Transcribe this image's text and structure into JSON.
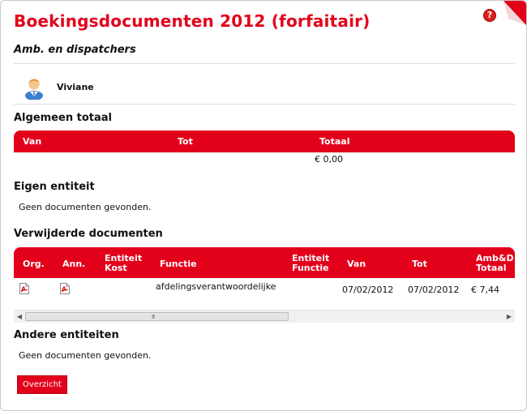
{
  "page": {
    "title": "Boekingsdocumenten 2012 (forfaitair)",
    "subtitle": "Amb. en dispatchers",
    "help_symbol": "?"
  },
  "user": {
    "name": "Viviane",
    "icon": "user-avatar-icon"
  },
  "general_total": {
    "heading": "Algemeen totaal",
    "columns": [
      "Van",
      "Tot",
      "Totaal"
    ],
    "row": {
      "van": "",
      "tot": "",
      "totaal": "€ 0,00"
    }
  },
  "own_entity": {
    "heading": "Eigen entiteit",
    "empty_text": "Geen documenten gevonden."
  },
  "removed_documents": {
    "heading": "Verwijderde documenten",
    "columns": {
      "org": "Org.",
      "ann": "Ann.",
      "entiteit_kost_1": "Entiteit",
      "entiteit_kost_2": "Kost",
      "functie": "Functie",
      "entiteit_functie_1": "Entiteit",
      "entiteit_functie_2": "Functie",
      "van": "Van",
      "tot": "Tot",
      "amb_totaal_1": "Amb&D",
      "amb_totaal_2": "Totaal"
    },
    "rows": [
      {
        "org_icon": "pdf-icon",
        "ann_icon": "pdf-icon",
        "entiteit_kost": "",
        "functie": "afdelingsverantwoordelijke",
        "entiteit_functie": "",
        "van": "07/02/2012",
        "tot": "07/02/2012",
        "amb_totaal": "€ 7,44"
      }
    ],
    "scroll": {
      "left_arrow": "◀",
      "right_arrow": "▶",
      "grip": "III"
    }
  },
  "other_entities": {
    "heading": "Andere entiteiten",
    "empty_text": "Geen documenten gevonden."
  },
  "actions": {
    "overview_label": "Overzicht"
  },
  "colors": {
    "accent": "#e3001b",
    "divider": "#dedede"
  }
}
